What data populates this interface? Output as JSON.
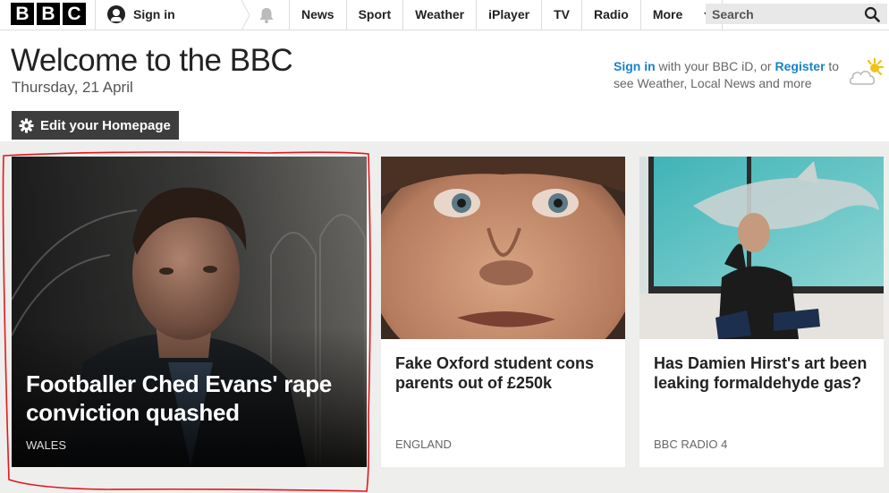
{
  "header": {
    "logo_letters": [
      "B",
      "B",
      "C"
    ],
    "signin_label": "Sign in",
    "nav": [
      "News",
      "Sport",
      "Weather",
      "iPlayer",
      "TV",
      "Radio"
    ],
    "more_label": "More",
    "search_placeholder": "Search"
  },
  "welcome": {
    "title": "Welcome to the BBC",
    "date": "Thursday, 21 April"
  },
  "promo": {
    "signin_link": "Sign in",
    "text1": " with your BBC iD, or ",
    "register_link": "Register",
    "text2": " to see Weather, Local News and more"
  },
  "edit_button": "Edit your Homepage",
  "stories": [
    {
      "headline": "Footballer Ched Evans' rape conviction quashed",
      "tag": "WALES"
    },
    {
      "headline": "Fake Oxford student cons parents out of £250k",
      "tag": "ENGLAND"
    },
    {
      "headline": "Has Damien Hirst's art been leaking formaldehyde gas?",
      "tag": "BBC RADIO 4"
    }
  ],
  "colors": {
    "link_blue": "#1a83c6",
    "annotation_red": "#e0191f",
    "button_dark": "#3d3d3d"
  },
  "icons": [
    "user-icon",
    "bell-icon",
    "search-icon",
    "gear-icon",
    "weather-cloud-sun-icon",
    "chevron-down-icon"
  ]
}
